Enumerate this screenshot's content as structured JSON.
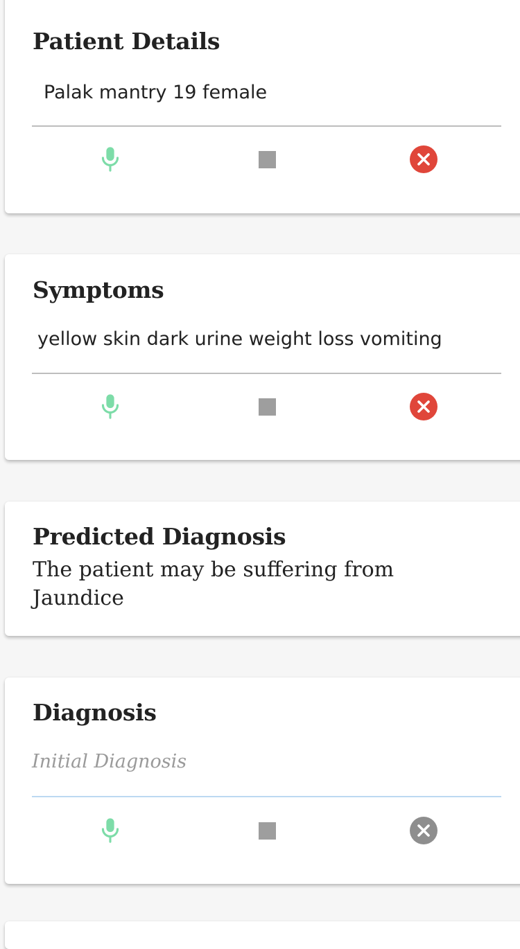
{
  "patient_details": {
    "title": "Patient Details",
    "value": "Palak mantry 19 female"
  },
  "symptoms": {
    "title": "Symptoms",
    "value": "yellow skin dark urine weight loss vomiting"
  },
  "predicted_diagnosis": {
    "title": "Predicted Diagnosis",
    "text": "The patient may be suffering from Jaundice"
  },
  "diagnosis": {
    "title": "Diagnosis",
    "placeholder": "Initial Diagnosis",
    "value": ""
  },
  "icons": {
    "mic": "microphone-icon",
    "stop": "stop-square-icon",
    "clear": "close-circle-icon"
  },
  "colors": {
    "mic_green": "#7ddca8",
    "stop_gray": "#9e9e9e",
    "clear_red": "#e0463a",
    "clear_gray": "#8e8e8e",
    "focus_underline": "#bcd9f2"
  }
}
